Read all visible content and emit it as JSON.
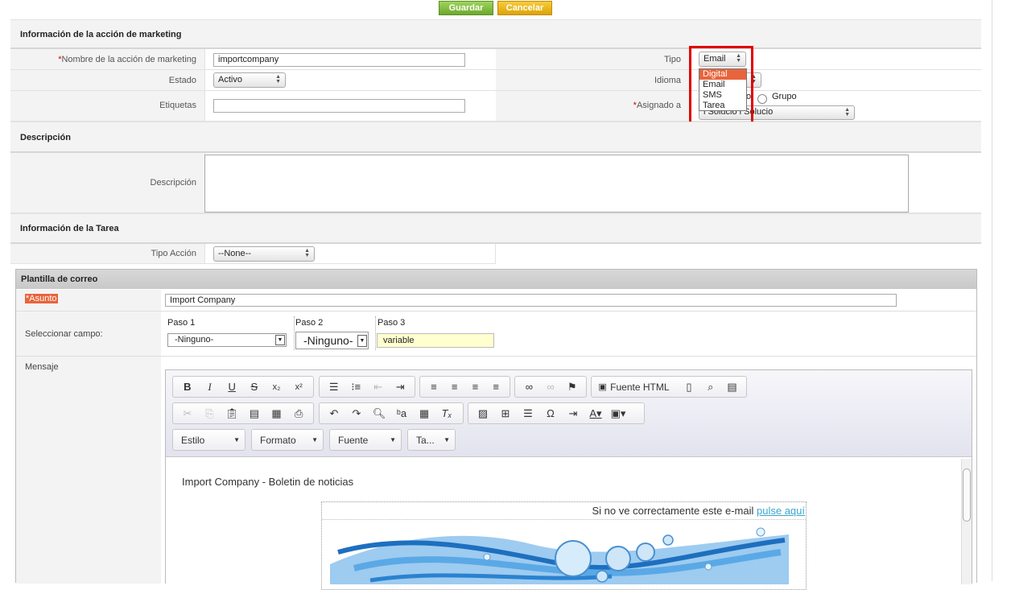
{
  "actions": {
    "save": "Guardar",
    "cancel": "Cancelar"
  },
  "sections": {
    "marketing": "Información de la acción de marketing",
    "description": "Descripción",
    "task": "Información de la Tarea"
  },
  "fields": {
    "name_label": "Nombre de la acción de marketing",
    "required_mark": "*",
    "name_value": "importcompany",
    "type_label": "Tipo",
    "type_value": "Email",
    "status_label": "Estado",
    "status_value": "Activo",
    "language_label": "Idioma",
    "tags_label": "Etiquetas",
    "assigned_label": "Asignado a",
    "assigned_group_label": "Grupo",
    "assigned_user_partial": "o",
    "assigned_value": "i Solucio i Solucio",
    "description_label": "Descripción",
    "task_type_label": "Tipo Acción",
    "task_type_value": "--None--"
  },
  "type_dropdown": {
    "options": [
      "Digital",
      "Email",
      "SMS",
      "Tarea"
    ],
    "highlighted": "Digital"
  },
  "template": {
    "header": "Plantilla de correo",
    "subject_label": "*Asunto",
    "subject_value": "Import Company",
    "select_field_label": "Seleccionar campo:",
    "step1_label": "Paso 1",
    "step1_value": "-Ninguno-",
    "step2_label": "Paso 2",
    "step2_value": "-Ninguno-",
    "step3_label": "Paso 3",
    "step3_value": "variable",
    "message_label": "Mensaje"
  },
  "editor": {
    "html_source_label": "Fuente HTML",
    "style_label": "Estilo",
    "format_label": "Formato",
    "font_label": "Fuente",
    "size_label": "Ta...",
    "content_title": "Import Company - Boletin de noticias",
    "view_text": "Si no ve correctamente este e-mail",
    "view_link": "pulse aquí"
  },
  "colors": {
    "highlight": "#e8643c",
    "red_box": "#e00000",
    "save": "#7cb83a",
    "cancel": "#eab20f",
    "link": "#3aa6d0"
  }
}
